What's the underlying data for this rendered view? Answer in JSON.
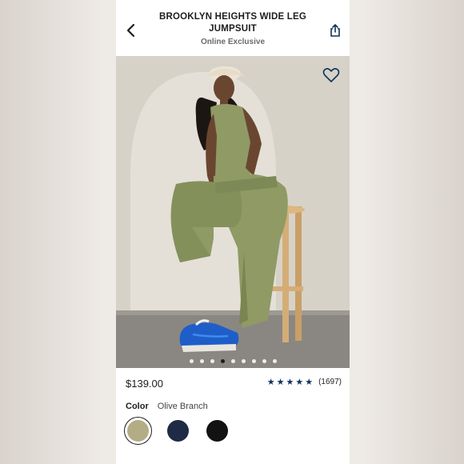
{
  "header": {
    "title": "BROOKLYN HEIGHTS WIDE LEG JUMPSUIT",
    "subtitle": "Online Exclusive",
    "back_icon": "chevron-left-icon",
    "share_icon": "share-icon"
  },
  "gallery": {
    "wishlist_icon": "heart-outline-icon",
    "image_count": 9,
    "active_index": 3
  },
  "product": {
    "price": "$139.00",
    "rating_stars": "★★★★★",
    "rating_value": 5,
    "review_count": "(1697)"
  },
  "color": {
    "label": "Color",
    "selected_name": "Olive Branch",
    "swatches": [
      {
        "name": "Olive Branch",
        "hex": "#b3ad86",
        "selected": true
      },
      {
        "name": "Navy",
        "hex": "#1f2a44",
        "selected": false
      },
      {
        "name": "Black",
        "hex": "#121212",
        "selected": false
      }
    ]
  },
  "colors": {
    "accent_star": "#10345a",
    "jumpsuit": "#8f9a64",
    "sneaker": "#1f5ec9"
  }
}
